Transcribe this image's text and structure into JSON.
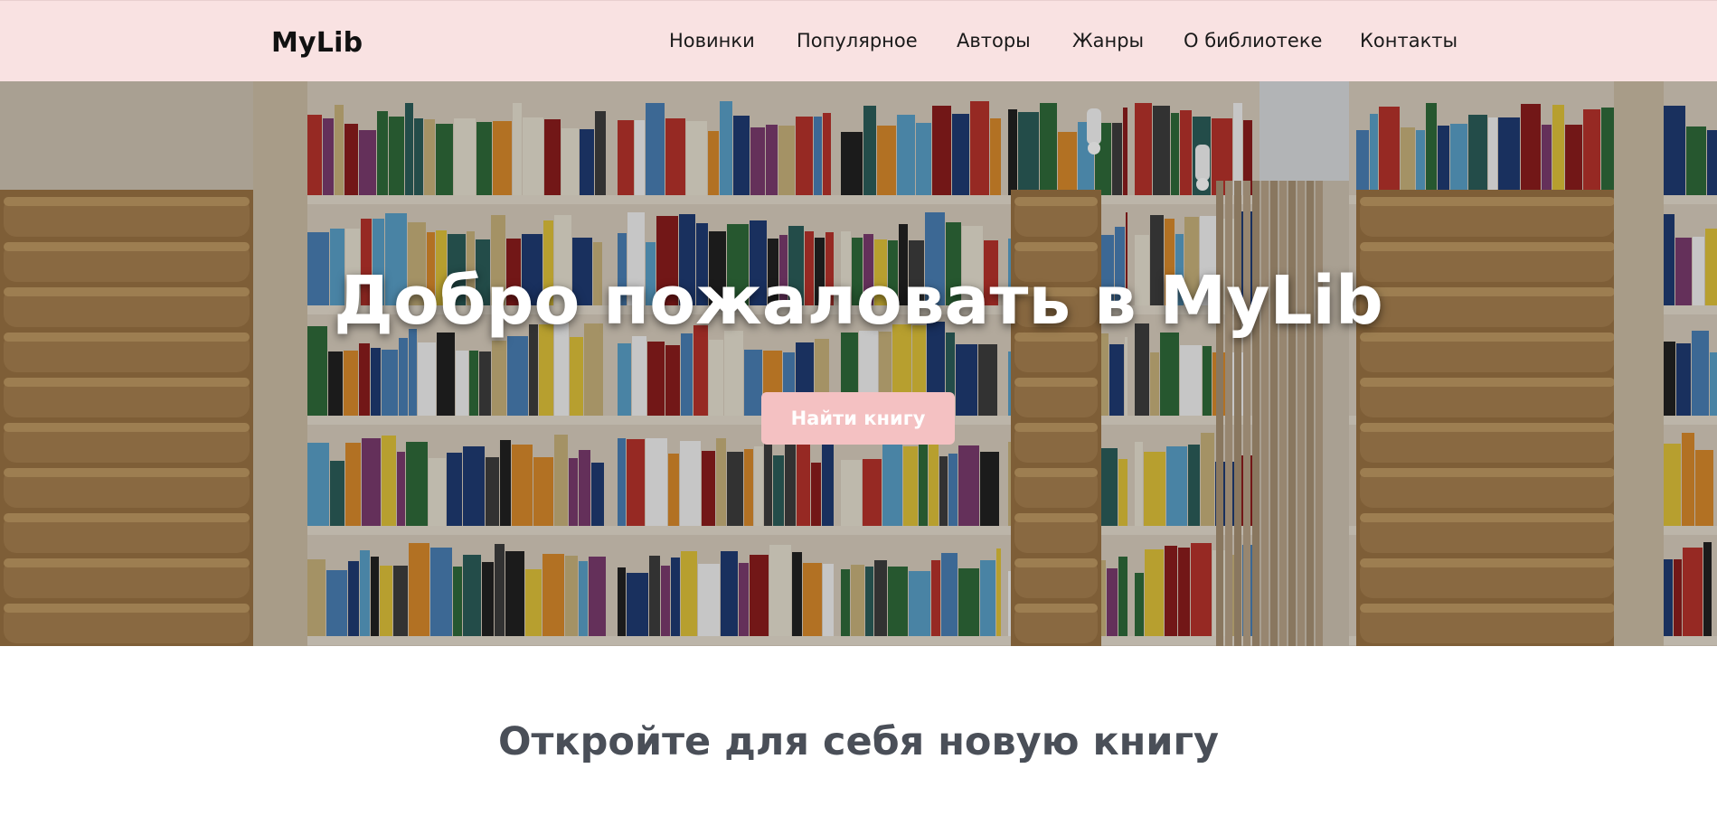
{
  "header": {
    "logo": "MyLib",
    "nav": [
      {
        "label": "Новинки"
      },
      {
        "label": "Популярное"
      },
      {
        "label": "Авторы"
      },
      {
        "label": "Жанры"
      },
      {
        "label": "О библиотеке"
      },
      {
        "label": "Контакты"
      }
    ]
  },
  "hero": {
    "title": "Добро пожаловать в MyLib",
    "button_label": "Найти книгу"
  },
  "section": {
    "title": "Откройте для себя новую книгу"
  },
  "colors": {
    "header_bg": "#f9e2e2",
    "button_bg": "#f4c1c2",
    "section_title": "#4a4f58"
  }
}
